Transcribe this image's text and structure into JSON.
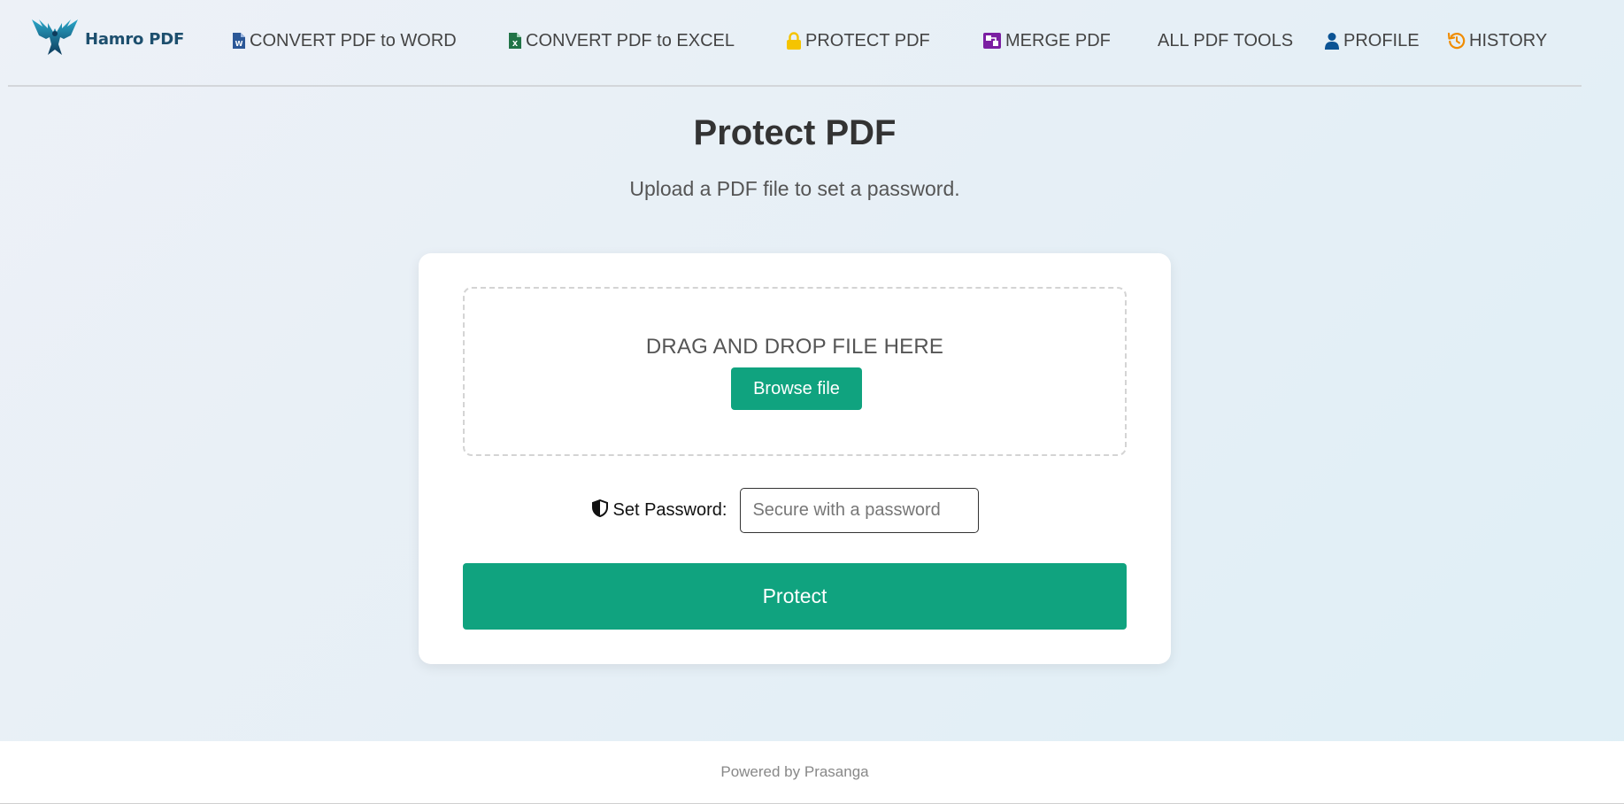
{
  "brand": {
    "name": "Hamro PDF",
    "logo_icon": "eagle-logo",
    "accent": "#1d4f6e"
  },
  "nav": {
    "items": [
      {
        "label": "CONVERT PDF to WORD",
        "icon": "word-file-icon",
        "color": "#2b5797"
      },
      {
        "label": "CONVERT PDF to EXCEL",
        "icon": "excel-file-icon",
        "color": "#217346"
      },
      {
        "label": "PROTECT PDF",
        "icon": "lock-icon",
        "color": "#f5c400"
      },
      {
        "label": "MERGE PDF",
        "icon": "merge-icon",
        "color": "#7b1fa2"
      },
      {
        "label": "ALL PDF TOOLS",
        "icon": "",
        "color": ""
      },
      {
        "label": "PROFILE",
        "icon": "user-icon",
        "color": "#0b5394"
      },
      {
        "label": "HISTORY",
        "icon": "history-icon",
        "color": "#f08c00"
      }
    ]
  },
  "page": {
    "title": "Protect PDF",
    "subtitle": "Upload a PDF file to set a password."
  },
  "upload": {
    "drop_label": "DRAG AND DROP FILE HERE",
    "browse_label": "Browse file"
  },
  "password": {
    "icon": "shield-icon",
    "label": "Set Password:",
    "placeholder": "Secure with a password",
    "value": ""
  },
  "actions": {
    "protect_label": "Protect",
    "accent": "#10a37f"
  },
  "footer": {
    "text": "Powered by Prasanga"
  }
}
